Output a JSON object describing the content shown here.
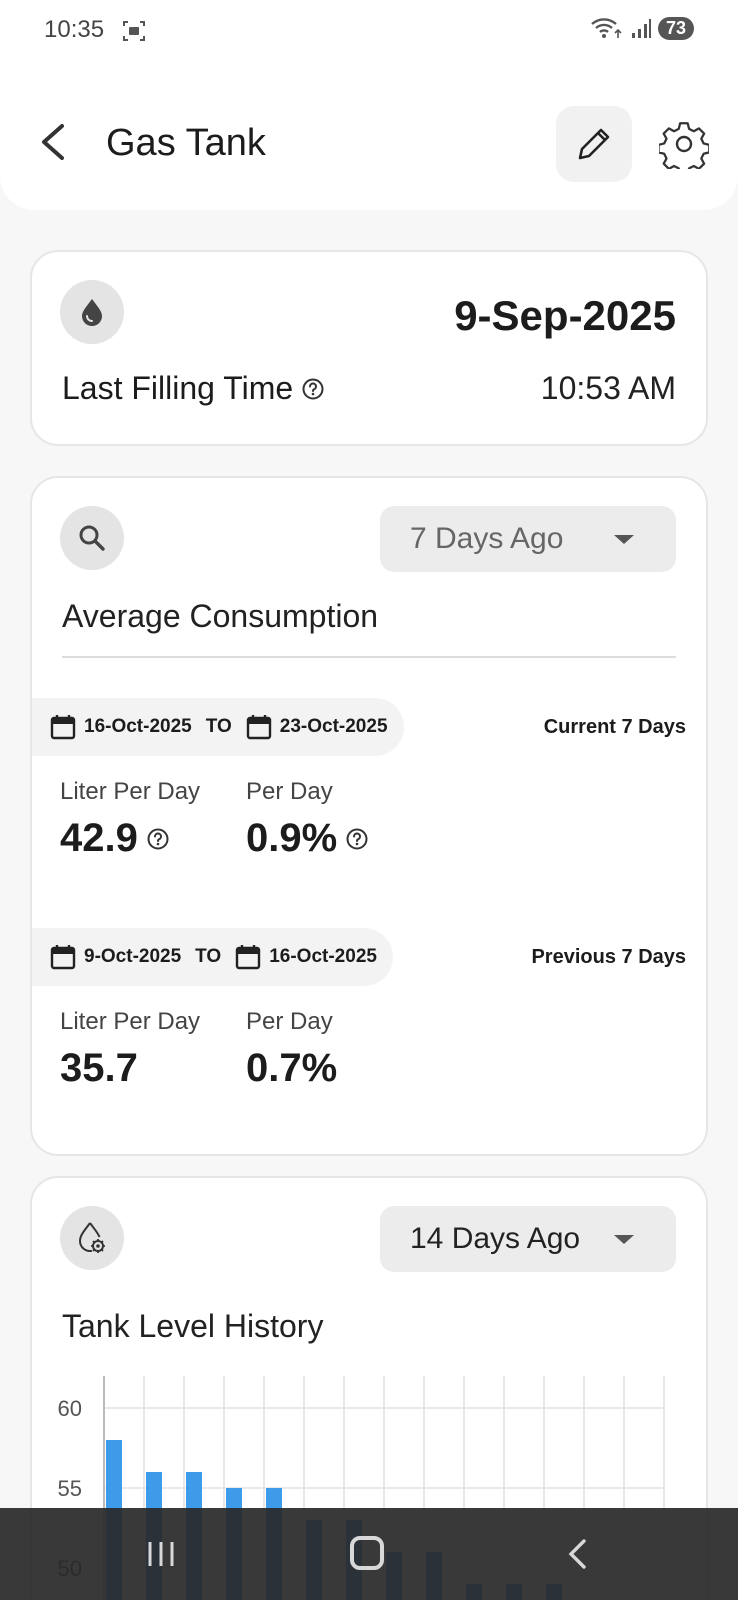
{
  "status_bar": {
    "time": "10:35",
    "battery": "73"
  },
  "app_bar": {
    "title": "Gas Tank"
  },
  "last_filling": {
    "date": "9-Sep-2025",
    "label": "Last Filling Time",
    "time": "10:53 AM"
  },
  "average_consumption": {
    "dropdown": "7 Days Ago",
    "title": "Average Consumption",
    "current": {
      "from": "16-Oct-2025",
      "to_label": "TO",
      "to": "23-Oct-2025",
      "period": "Current 7 Days",
      "liter_label": "Liter Per Day",
      "liter_value": "42.9",
      "per_day_label": "Per Day",
      "per_day_value": "0.9%"
    },
    "previous": {
      "from": "9-Oct-2025",
      "to_label": "TO",
      "to": "16-Oct-2025",
      "period": "Previous 7 Days",
      "liter_label": "Liter Per Day",
      "liter_value": "35.7",
      "per_day_label": "Per Day",
      "per_day_value": "0.7%"
    }
  },
  "tank_history": {
    "dropdown": "14 Days Ago",
    "title": "Tank Level History"
  },
  "chart_data": {
    "type": "bar",
    "title": "",
    "xlabel": "",
    "ylabel": "",
    "y_ticks": [
      "60",
      "55",
      "50"
    ],
    "ylim_visible": [
      48,
      62
    ],
    "values": [
      58,
      56,
      56,
      55,
      55,
      53,
      53,
      51,
      51,
      49,
      49,
      49
    ],
    "grid": true,
    "colors": {
      "bar": "#3d9be9",
      "grid": "#e2e2e2"
    }
  }
}
